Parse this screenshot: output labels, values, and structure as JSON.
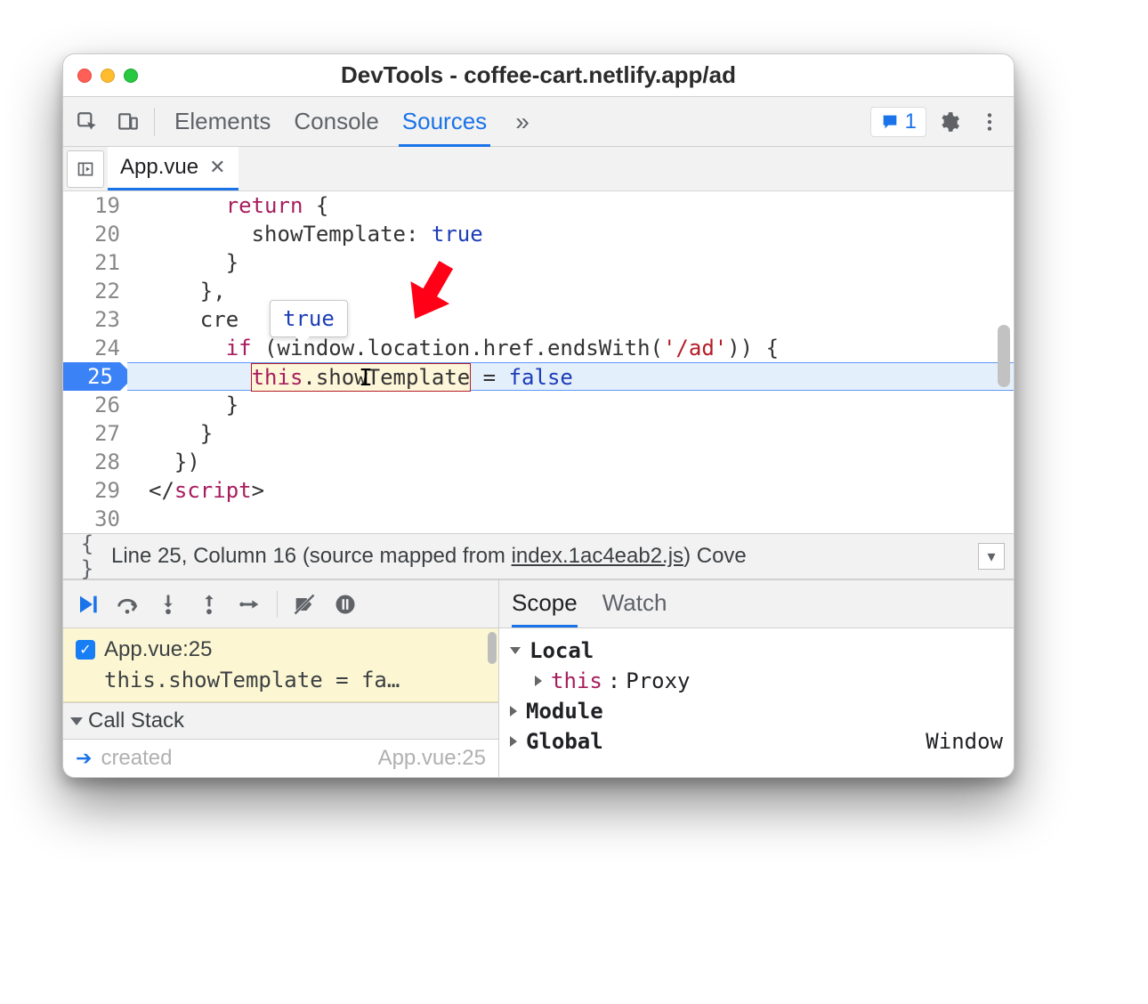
{
  "window_title": "DevTools - coffee-cart.netlify.app/ad",
  "panel_tabs": {
    "elements": "Elements",
    "console": "Console",
    "sources": "Sources"
  },
  "more_symbol": "»",
  "issues_count": "1",
  "file_tab": {
    "name": "App.vue"
  },
  "gutter": {
    "l19": "19",
    "l20": "20",
    "l21": "21",
    "l22": "22",
    "l23": "23",
    "l24": "24",
    "l25": "25",
    "l26": "26",
    "l27": "27",
    "l28": "28",
    "l29": "29",
    "l30": "30"
  },
  "code": {
    "l19_kw": "return",
    "l19_rest": " {",
    "l20": "showTemplate: ",
    "l20_true": "true",
    "l21": "}",
    "l22": "},",
    "l23_pre": "cre",
    "l23_post": " {",
    "l24_if": "if",
    "l24_w": " (window.location.href.endsWith(",
    "l24_str": "'/ad'",
    "l24_end": ")) {",
    "l25_this": "this",
    "l25_expr": ".showTemplate",
    "l25_assign": " = ",
    "l25_false": "false",
    "l26": "}",
    "l27": "}",
    "l28": "})",
    "l29_open": "</",
    "l29_tag": "script",
    "l29_close": ">",
    "l30": ""
  },
  "tooltip_value": "true",
  "status": {
    "position": "Line 25, Column 16",
    "mapped_pre": "(source mapped from ",
    "mapped_file": "index.1ac4eab2.js",
    "mapped_post": ")",
    "coverage": " Cove"
  },
  "breakpoint": {
    "file": "App.vue:25",
    "snippet": "this.showTemplate = fa…"
  },
  "call_stack_header": "Call Stack",
  "call_stack": {
    "frame_name": "created",
    "frame_loc": "App.vue:25"
  },
  "scope_tabs": {
    "scope": "Scope",
    "watch": "Watch"
  },
  "scope": {
    "local": "Local",
    "this_key": "this",
    "this_val": "Proxy",
    "module": "Module",
    "global": "Global",
    "global_val": "Window"
  }
}
